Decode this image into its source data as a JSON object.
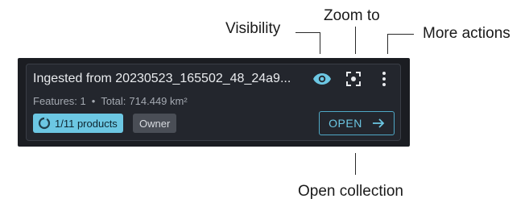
{
  "callouts": {
    "visibility": "Visibility",
    "zoom_to": "Zoom to",
    "more_actions": "More actions",
    "open_collection": "Open collection"
  },
  "card": {
    "title": "Ingested from 20230523_165502_48_24a9...",
    "features_label": "Features: 1",
    "total_label": "Total:",
    "total_value": "714.449 km²",
    "products_badge": "1/11 products",
    "products_progress": 0.09,
    "owner_badge": "Owner",
    "open_button": "OPEN",
    "icons": {
      "visibility": "eye-icon",
      "zoom": "focus-icon",
      "more": "kebab-menu-icon",
      "open": "arrow-right-icon",
      "progress": "progress-ring-icon"
    }
  },
  "colors": {
    "accent": "#6cc7e3",
    "card_bg": "#23262d",
    "outer_bg": "#1b1d22",
    "owner_bg": "#4a4e56"
  }
}
